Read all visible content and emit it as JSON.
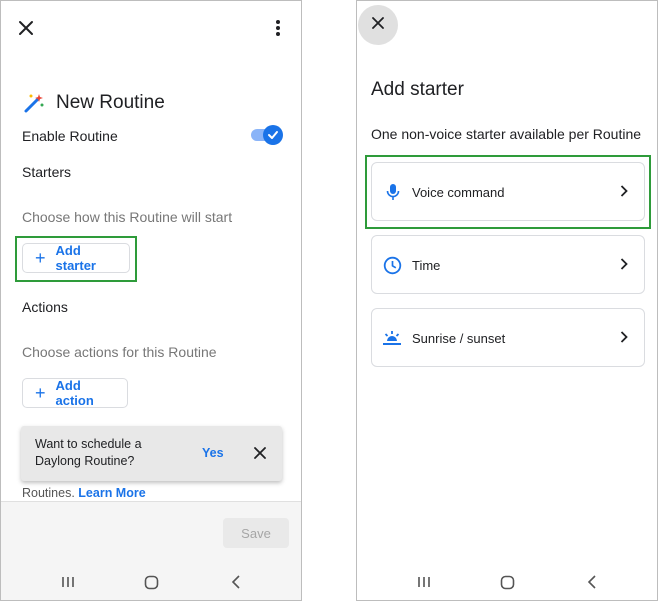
{
  "left": {
    "title": "New Routine",
    "enable_label": "Enable Routine",
    "enable_on": true,
    "starters_heading": "Starters",
    "starters_hint": "Choose how this Routine will start",
    "add_starter_label": "Add starter",
    "actions_heading": "Actions",
    "actions_hint": "Choose actions for this Routine",
    "add_action_label": "Add action",
    "snackbar": {
      "line1": "Want to schedule a",
      "line2": "Daylong Routine?",
      "yes_label": "Yes"
    },
    "footer_text": "Routines.",
    "learn_more": "Learn More",
    "save_label": "Save"
  },
  "right": {
    "title": "Add starter",
    "subtitle": "One non-voice starter available per Routine",
    "options": [
      {
        "label": "Voice command",
        "icon": "microphone-icon"
      },
      {
        "label": "Time",
        "icon": "clock-icon"
      },
      {
        "label": "Sunrise / sunset",
        "icon": "sunrise-icon"
      }
    ]
  },
  "colors": {
    "accent": "#1a73e8",
    "highlight": "#2e9b3a"
  }
}
